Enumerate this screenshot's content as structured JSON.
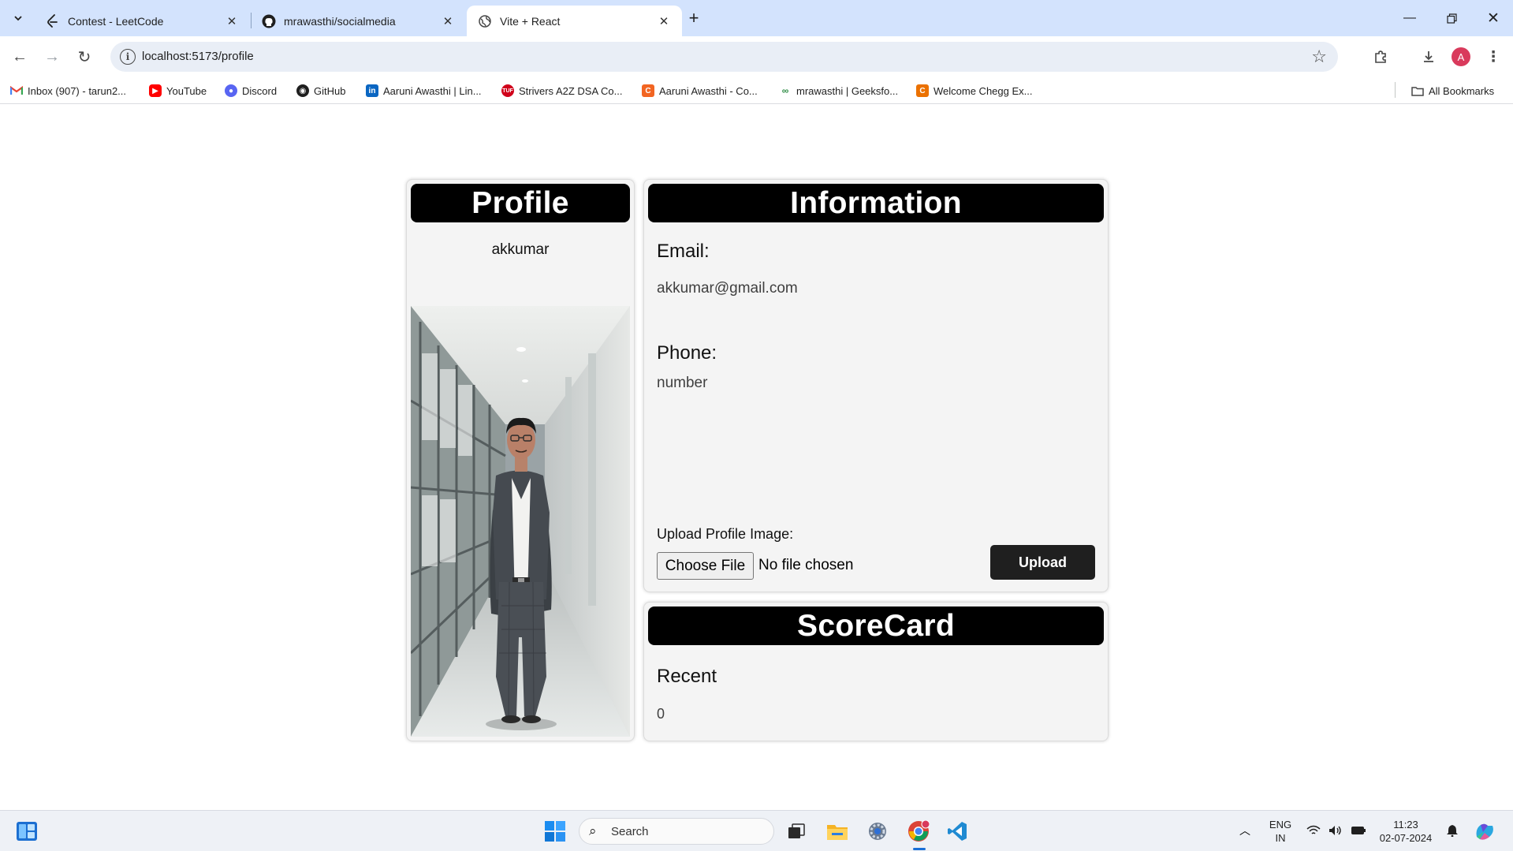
{
  "browser": {
    "tabs": [
      {
        "title": "Contest - LeetCode",
        "icon": "leetcode-icon",
        "active": false
      },
      {
        "title": "mrawasthi/socialmedia",
        "icon": "github-icon",
        "active": false
      },
      {
        "title": "Vite + React",
        "icon": "globe-icon",
        "active": true
      }
    ],
    "url": "localhost:5173/profile",
    "profile_initial": "A",
    "bookmarks": [
      {
        "label": "Inbox (907) - tarun2...",
        "icon": "gmail-icon"
      },
      {
        "label": "YouTube",
        "icon": "youtube-icon"
      },
      {
        "label": "Discord",
        "icon": "discord-icon"
      },
      {
        "label": "GitHub",
        "icon": "github-icon"
      },
      {
        "label": "Aaruni Awasthi | Lin...",
        "icon": "linkedin-icon"
      },
      {
        "label": "Strivers A2Z DSA Co...",
        "icon": "tuf-icon"
      },
      {
        "label": "Aaruni Awasthi - Co...",
        "icon": "codolio-icon"
      },
      {
        "label": "mrawasthi | Geeksfo...",
        "icon": "geeksforgeeks-icon"
      },
      {
        "label": "Welcome Chegg Ex...",
        "icon": "chegg-icon"
      }
    ],
    "all_bookmarks": "All Bookmarks"
  },
  "profile": {
    "heading": "Profile",
    "username": "akkumar"
  },
  "information": {
    "heading": "Information",
    "email_label": "Email:",
    "email_value": "akkumar@gmail.com",
    "phone_label": "Phone:",
    "phone_value": "number",
    "upload_label": "Upload Profile Image:",
    "choose_file": "Choose File",
    "no_file": "No file chosen",
    "upload_button": "Upload"
  },
  "scorecard": {
    "heading": "ScoreCard",
    "recent_label": "Recent",
    "recent_value": "0"
  },
  "taskbar": {
    "search_placeholder": "Search",
    "lang_line1": "ENG",
    "lang_line2": "IN",
    "time": "11:23",
    "date": "02-07-2024"
  },
  "colors": {
    "tabstrip": "#d3e3fd",
    "banner": "#000000",
    "card": "#f4f4f4",
    "upload_button": "#1f1f1f"
  }
}
